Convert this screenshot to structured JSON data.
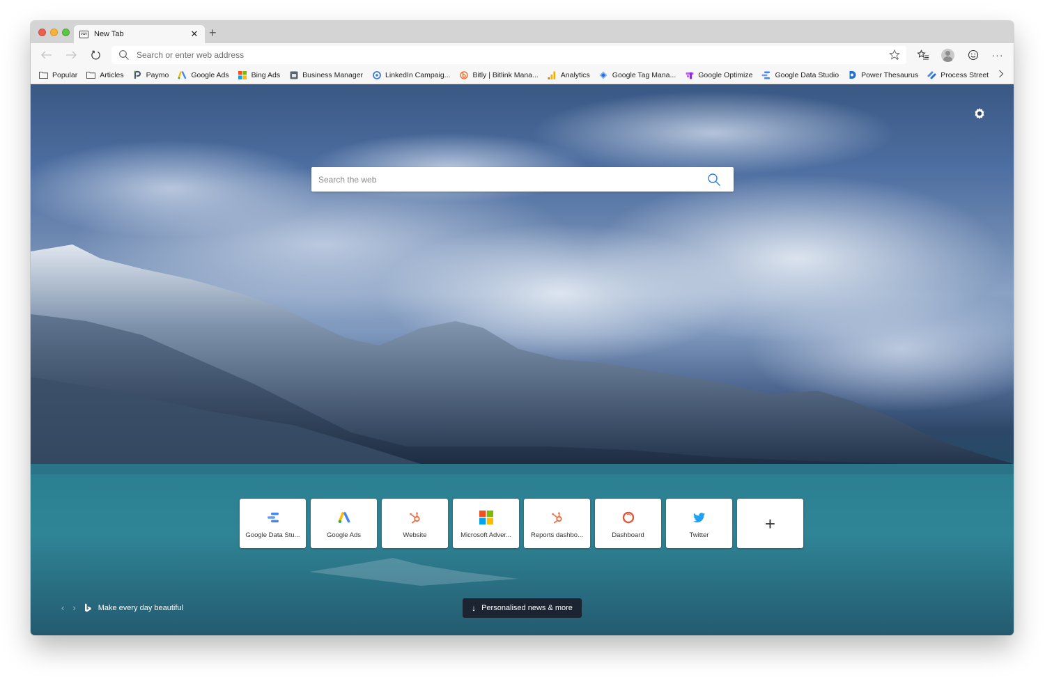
{
  "window": {
    "tab": {
      "title": "New Tab",
      "close_icon": "close-icon"
    },
    "new_tab_label": "+"
  },
  "toolbar": {
    "back_icon": "arrow-left-icon",
    "forward_icon": "arrow-right-icon",
    "reload_icon": "reload-icon",
    "address_placeholder": "Search or enter web address",
    "address_value": "",
    "more_label": "···"
  },
  "bookmarks": [
    {
      "label": "Popular",
      "icon": "folder-icon"
    },
    {
      "label": "Articles",
      "icon": "folder-icon"
    },
    {
      "label": "Paymo",
      "icon": "paymo-icon"
    },
    {
      "label": "Google Ads",
      "icon": "google-ads-icon"
    },
    {
      "label": "Bing Ads",
      "icon": "microsoft-icon"
    },
    {
      "label": "Business Manager",
      "icon": "business-manager-icon"
    },
    {
      "label": "LinkedIn Campaig...",
      "icon": "linkedin-campaign-icon"
    },
    {
      "label": "Bitly | Bitlink Mana...",
      "icon": "bitly-icon"
    },
    {
      "label": "Analytics",
      "icon": "analytics-icon"
    },
    {
      "label": "Google Tag Mana...",
      "icon": "tag-manager-icon"
    },
    {
      "label": "Google Optimize",
      "icon": "optimize-icon"
    },
    {
      "label": "Google Data Studio",
      "icon": "data-studio-icon"
    },
    {
      "label": "Power Thesaurus",
      "icon": "power-thesaurus-icon"
    },
    {
      "label": "Process Street",
      "icon": "process-street-icon"
    }
  ],
  "newtab": {
    "search_placeholder": "Search the web",
    "search_value": "",
    "tiles": [
      {
        "label": "Google Data Stu...",
        "icon": "data-studio-icon"
      },
      {
        "label": "Google Ads",
        "icon": "google-ads-icon"
      },
      {
        "label": "Website",
        "icon": "hubspot-icon"
      },
      {
        "label": "Microsoft Adver...",
        "icon": "microsoft-icon"
      },
      {
        "label": "Reports dashbo...",
        "icon": "hubspot-icon"
      },
      {
        "label": "Dashboard",
        "icon": "dashboard-ring-icon"
      },
      {
        "label": "Twitter",
        "icon": "twitter-icon"
      }
    ],
    "add_tile_label": "+",
    "image_caption": "Make every day beautiful",
    "news_button": "Personalised news & more",
    "prev_label": "‹",
    "next_label": "›"
  },
  "colors": {
    "accent_blue": "#3c82f6",
    "hubspot_orange": "#f0683c",
    "twitter_blue": "#1da1f2"
  }
}
